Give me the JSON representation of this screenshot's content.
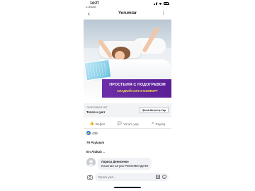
{
  "status_bar": {
    "time": "14:27",
    "back_app": "◂ Cihazda"
  },
  "nav": {
    "title": "Yorumlar",
    "back_glyph": "‹",
    "more_glyph": "⋮"
  },
  "ad": {
    "promo_title": "ПРОСТЫНЯ С ПОДОГРЕВОМ",
    "promo_subtitle": "СЛАДКИЙ СОН И КОМФОРТ",
    "url": "TURKCEBANT.NET",
    "headline": "Тепло и уют",
    "cta_label": "Şimdi Alışveriş Yap"
  },
  "actions": [
    {
      "icon": "like-icon",
      "glyph": "👍",
      "label": "Beğen"
    },
    {
      "icon": "comment-icon",
      "glyph": "💬",
      "label": "Yorum yap"
    },
    {
      "icon": "share-icon",
      "glyph": "↗",
      "label": "Paylaş"
    }
  ],
  "reactions": {
    "count": "438",
    "badge_glyph": "👍"
  },
  "shares": "79 Paylaşım",
  "sort": {
    "label": "En Alakalı",
    "chevron": "⌄"
  },
  "comment": {
    "author": "Лариса Денисенко",
    "text": "Класная штука РЕКОМЕНДУЮ"
  },
  "composer": {
    "placeholder": "Yorum yaz...",
    "gif_label": "GIF",
    "emoji_glyph": "☺"
  },
  "colors": {
    "accent": "#1877f2",
    "promo_purple": "#6d2fa8",
    "promo_yellow": "#ffe14a"
  }
}
